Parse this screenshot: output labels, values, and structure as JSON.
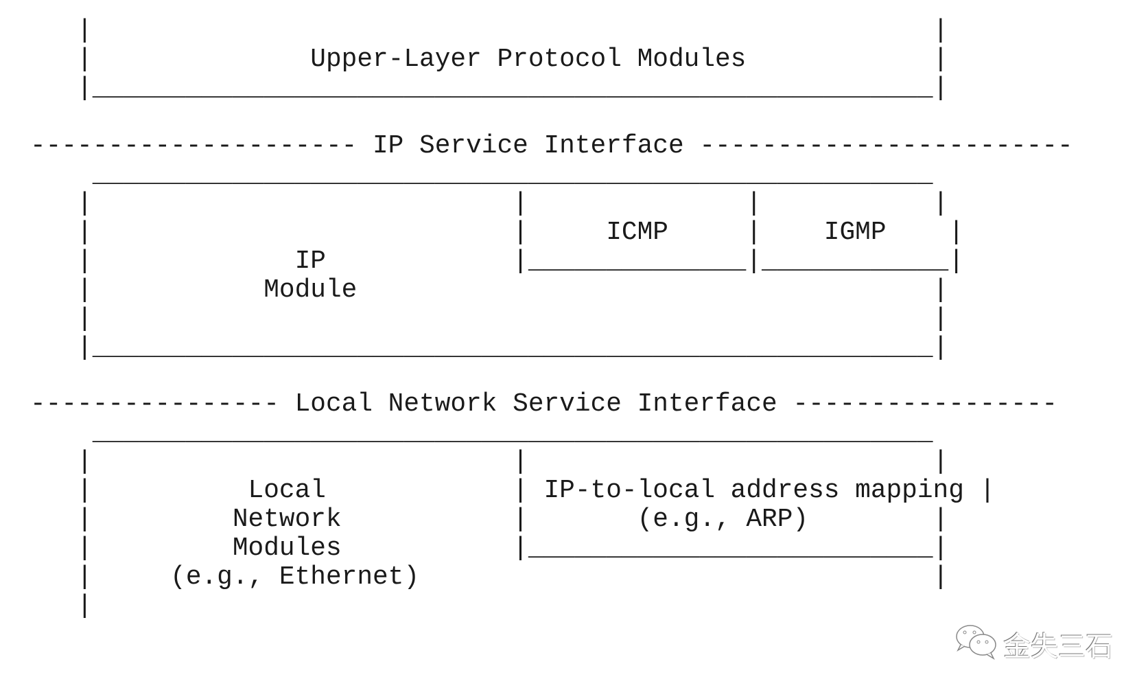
{
  "diagram": {
    "lines": [
      "   |                                                      |",
      "   |              Upper-Layer Protocol Modules            |",
      "   |______________________________________________________|",
      "",
      "--------------------- IP Service Interface ------------------------",
      "    ______________________________________________________",
      "   |                           |              |           |",
      "   |                           |     ICMP     |    IGMP    |",
      "   |             IP            |______________|____________|",
      "   |           Module                                     |",
      "   |                                                      |",
      "   |______________________________________________________|",
      "",
      "---------------- Local Network Service Interface -----------------",
      "    ______________________________________________________",
      "   |                           |                          |",
      "   |          Local            | IP-to-local address mapping |",
      "   |         Network           |       (e.g., ARP)        |",
      "   |         Modules           |__________________________|",
      "   |     (e.g., Ethernet)                                 |",
      "   |"
    ],
    "labels": {
      "upper_layer": "Upper-Layer Protocol Modules",
      "ip_service_interface": "IP Service Interface",
      "ip_module": "IP Module",
      "icmp": "ICMP",
      "igmp": "IGMP",
      "local_network_service_interface": "Local Network Service Interface",
      "local_network_modules": "Local Network Modules (e.g., Ethernet)",
      "address_mapping": "IP-to-local address mapping (e.g., ARP)"
    }
  },
  "watermark": {
    "icon": "wechat-icon",
    "text": "金失三石"
  }
}
